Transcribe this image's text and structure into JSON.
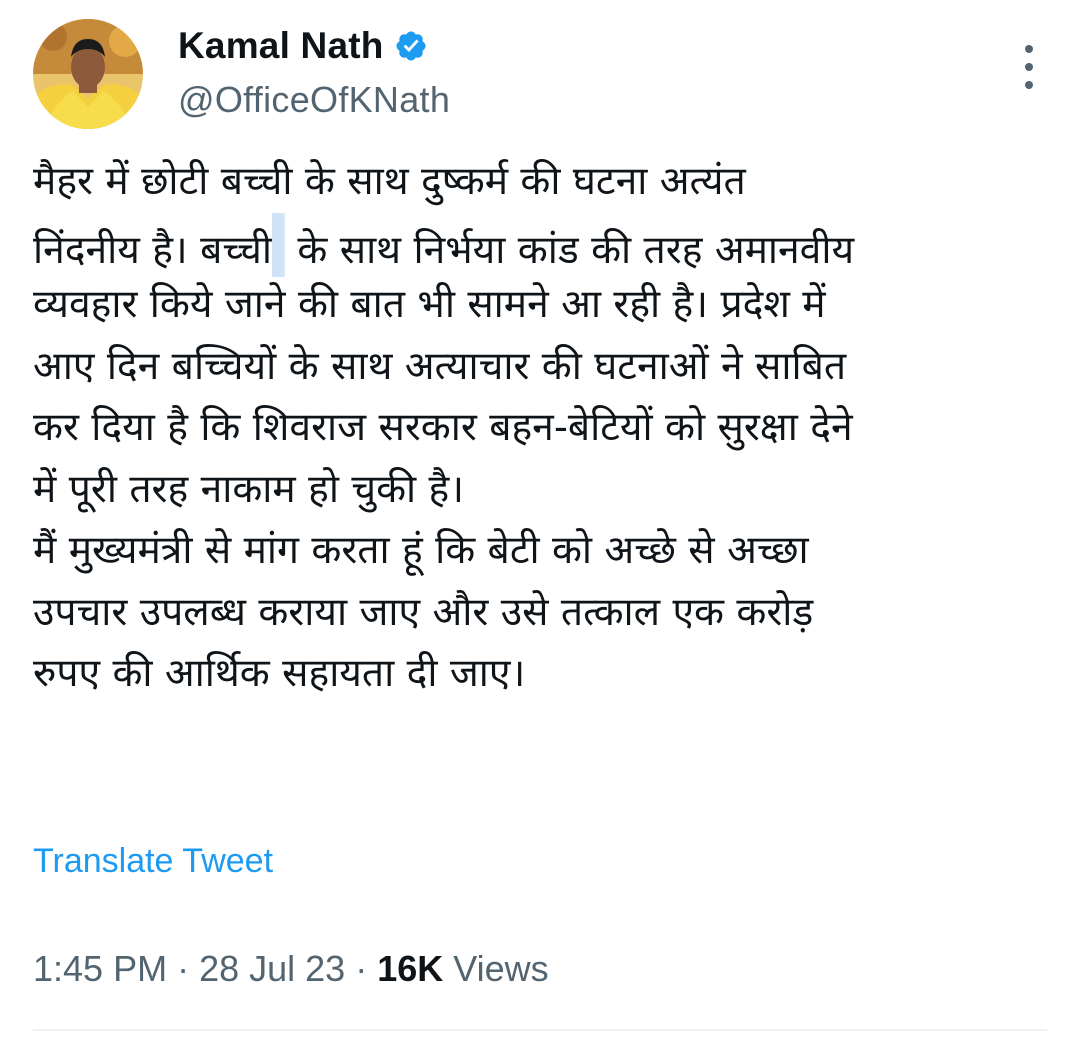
{
  "author": {
    "display_name": "Kamal Nath",
    "handle": "@OfficeOfKNath",
    "verified": true,
    "verified_color": "#1d9bf0",
    "avatar_icon": "profile-photo"
  },
  "tweet": {
    "lines": [
      "मैहर में छोटी बच्ची के साथ दुष्कर्म की घटना अत्यंत",
      "निंदनीय है। बच्ची",
      "के साथ निर्भया कांड की तरह अमानवीय",
      "व्यवहार किये जाने की बात भी सामने आ रही है। प्रदेश में",
      "आए दिन बच्चियों के साथ अत्याचार की घटनाओं ने साबित",
      "कर दिया है कि शिवराज सरकार बहन-बेटियों को सुरक्षा देने",
      "में पूरी तरह नाकाम हो चुकी है।",
      "मैं मुख्यमंत्री से मांग करता हूं कि बेटी को अच्छे से अच्छा",
      "उपचार उपलब्ध कराया जाए और उसे तत्काल एक करोड़",
      "रुपए की आर्थिक सहायता दी जाए।"
    ],
    "translate_label": "Translate Tweet",
    "time": "1:45 PM",
    "separator": "·",
    "date": "28 Jul 23",
    "views_count": "16K",
    "views_label": "Views"
  },
  "colors": {
    "text": "#0f1419",
    "secondary": "#536471",
    "link": "#1d9bf0"
  },
  "icons": {
    "more": "more-options-icon",
    "verified": "verified-badge-icon"
  }
}
